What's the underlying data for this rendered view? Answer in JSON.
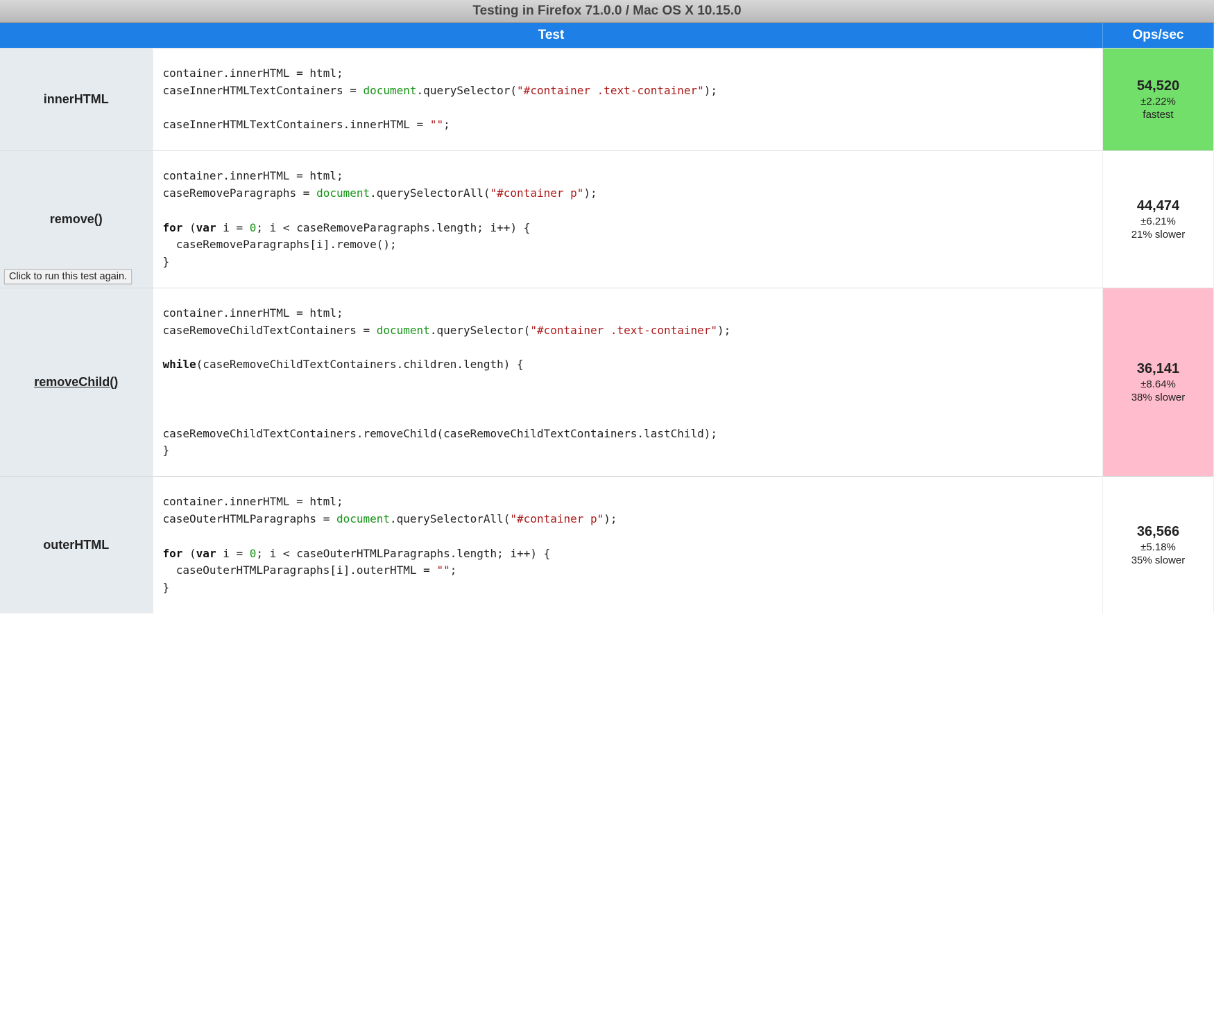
{
  "titlebar": "Testing in Firefox 71.0.0 / Mac OS X 10.15.0",
  "header": {
    "test": "Test",
    "ops": "Ops/sec"
  },
  "tooltip": "Click to run this test again.",
  "tests": [
    {
      "name": "innerHTML",
      "hovered": false,
      "code_html": "container.innerHTML = html;\ncaseInnerHTMLTextContainers = <span class=\"tok-doc\">document</span>.querySelector(<span class=\"tok-str\">\"#container .text-container\"</span>);\n\ncaseInnerHTMLTextContainers.innerHTML = <span class=\"tok-str\">\"\"</span>;",
      "ops": "54,520",
      "pct": "±2.22%",
      "note": "fastest",
      "highlight": "fastest"
    },
    {
      "name": "remove()",
      "hovered": false,
      "code_html": "container.innerHTML = html;\ncaseRemoveParagraphs = <span class=\"tok-doc\">document</span>.querySelectorAll(<span class=\"tok-str\">\"#container p\"</span>);\n\n<span class=\"tok-kw\">for</span> (<span class=\"tok-kw\">var</span> i = <span class=\"tok-num\">0</span>; i &lt; caseRemoveParagraphs.length; i++) {\n  caseRemoveParagraphs[i].remove();\n}",
      "ops": "44,474",
      "pct": "±6.21%",
      "note": "21% slower",
      "highlight": ""
    },
    {
      "name": "removeChild()",
      "hovered": true,
      "code_html": "container.innerHTML = html;\ncaseRemoveChildTextContainers = <span class=\"tok-doc\">document</span>.querySelector(<span class=\"tok-str\">\"#container .text-container\"</span>);\n\n<span class=\"tok-kw\">while</span>(caseRemoveChildTextContainers.children.length) {\n\n\n\ncaseRemoveChildTextContainers.removeChild(caseRemoveChildTextContainers.lastChild);\n}",
      "ops": "36,141",
      "pct": "±8.64%",
      "note": "38% slower",
      "highlight": "slowest"
    },
    {
      "name": "outerHTML",
      "hovered": false,
      "code_html": "container.innerHTML = html;\ncaseOuterHTMLParagraphs = <span class=\"tok-doc\">document</span>.querySelectorAll(<span class=\"tok-str\">\"#container p\"</span>);\n\n<span class=\"tok-kw\">for</span> (<span class=\"tok-kw\">var</span> i = <span class=\"tok-num\">0</span>; i &lt; caseOuterHTMLParagraphs.length; i++) {\n  caseOuterHTMLParagraphs[i].outerHTML = <span class=\"tok-str\">\"\"</span>;\n}",
      "ops": "36,566",
      "pct": "±5.18%",
      "note": "35% slower",
      "highlight": ""
    }
  ]
}
